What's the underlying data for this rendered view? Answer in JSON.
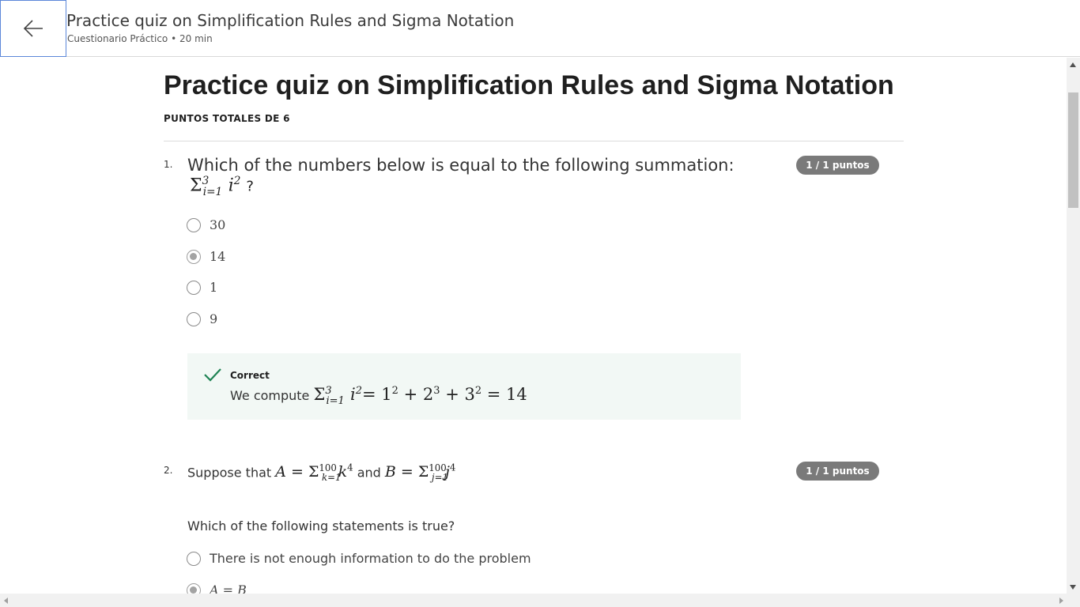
{
  "header": {
    "title": "Practice quiz on Simplification Rules and Sigma Notation",
    "subtitle": "Cuestionario Práctico • 20 min",
    "back_icon": "arrow-left-icon"
  },
  "page": {
    "title": "Practice quiz on Simplification Rules and Sigma Notation",
    "total_points": "PUNTOS TOTALES DE 6"
  },
  "questions": [
    {
      "number": "1.",
      "text": "Which of the numbers below is equal to the following summation:",
      "math": {
        "sigma": "Σ",
        "sub": "i=1",
        "sup": "3",
        "var": "i",
        "exp": "2",
        "suffix": "?"
      },
      "score": "1 / 1 puntos",
      "options": [
        {
          "label": "30",
          "selected": false
        },
        {
          "label": "14",
          "selected": true
        },
        {
          "label": "1",
          "selected": false
        },
        {
          "label": "9",
          "selected": false
        }
      ],
      "feedback": {
        "status": "Correct",
        "prefix": "We compute",
        "math": {
          "sigma": "Σ",
          "sub": "i=1",
          "sup": "3",
          "var": "i",
          "exp": "2",
          "rest": "= 1",
          "e1": "2",
          "p1": " + 2",
          "e2": "3",
          "p2": " + 3",
          "e3": "2",
          "result": " = 14"
        }
      }
    },
    {
      "number": "2.",
      "prefix": "Suppose that",
      "math_a": {
        "lhs": "A",
        "eq": " = Σ",
        "sub": "k=1",
        "sup": "100",
        "var": "k",
        "exp": "4"
      },
      "and": "and",
      "math_b": {
        "lhs": "B",
        "eq": " = Σ",
        "sub": "j=1",
        "sup": "100",
        "var": "j",
        "exp": "4"
      },
      "ask": "Which of the following statements is true?",
      "score": "1 / 1 puntos",
      "options": [
        {
          "label": "There is not enough information to do the problem",
          "selected": false
        },
        {
          "label": "A = B",
          "selected": true
        }
      ]
    }
  ]
}
